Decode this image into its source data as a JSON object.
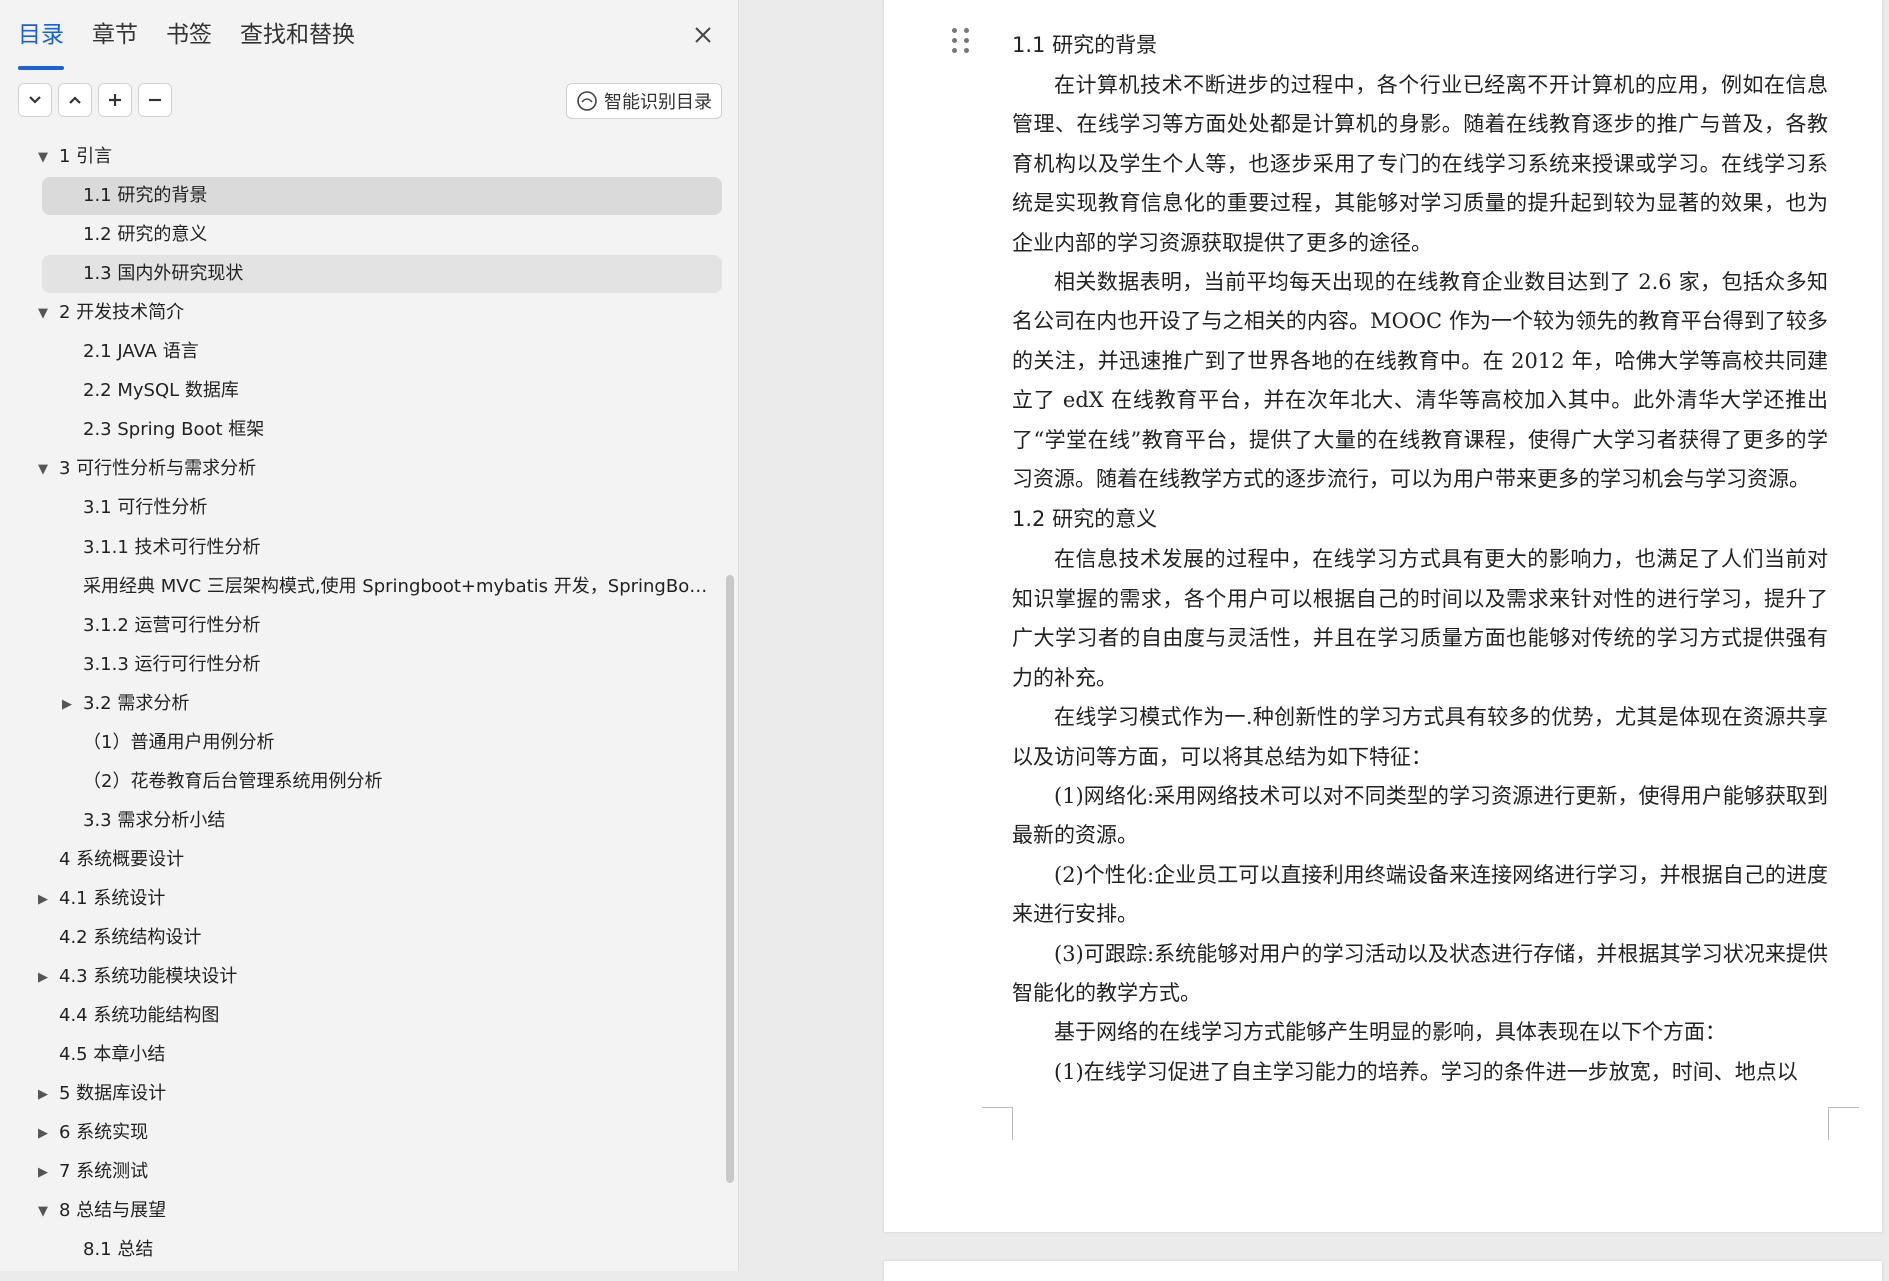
{
  "sidebar": {
    "tabs": [
      "目录",
      "章节",
      "书签",
      "查找和替换"
    ],
    "smart_label": "智能识别目录",
    "toc": [
      {
        "label": "1 引言"
      },
      {
        "label": "1.1 研究的背景"
      },
      {
        "label": "1.2 研究的意义"
      },
      {
        "label": "1.3 国内外研究现状"
      },
      {
        "label": "2 开发技术简介"
      },
      {
        "label": "2.1 JAVA 语言"
      },
      {
        "label": "2.2 MySQL 数据库"
      },
      {
        "label": "2.3 Spring Boot 框架"
      },
      {
        "label": "3 可行性分析与需求分析"
      },
      {
        "label": "3.1 可行性分析"
      },
      {
        "label": "3.1.1 技术可行性分析"
      },
      {
        "label": "采用经典 MVC 三层架构模式,使用 Springboot+mybatis 开发，SpringBoot ..."
      },
      {
        "label": "3.1.2 运营可行性分析"
      },
      {
        "label": "3.1.3 运行可行性分析"
      },
      {
        "label": "3.2 需求分析"
      },
      {
        "label": "（1）普通用户用例分析"
      },
      {
        "label": "（2）花卷教育后台管理系统用例分析"
      },
      {
        "label": "3.3 需求分析小结"
      },
      {
        "label": "4 系统概要设计"
      },
      {
        "label": "4.1 系统设计"
      },
      {
        "label": "4.2 系统结构设计"
      },
      {
        "label": "4.3 系统功能模块设计"
      },
      {
        "label": "4.4 系统功能结构图"
      },
      {
        "label": "4.5 本章小结"
      },
      {
        "label": "5 数据库设计"
      },
      {
        "label": "6 系统实现"
      },
      {
        "label": "7 系统测试"
      },
      {
        "label": "8 总结与展望"
      },
      {
        "label": "8.1 总结"
      }
    ]
  },
  "document": {
    "h1": "1.1 研究的背景",
    "p1": "在计算机技术不断进步的过程中，各个行业已经离不开计算机的应用，例如在信息管理、在线学习等方面处处都是计算机的身影。随着在线教育逐步的推广与普及，各教育机构以及学生个人等，也逐步采用了专门的在线学习系统来授课或学习。在线学习系统是实现教育信息化的重要过程，其能够对学习质量的提升起到较为显著的效果，也为企业内部的学习资源获取提供了更多的途径。",
    "p2": "相关数据表明，当前平均每天出现的在线教育企业数目达到了 2.6 家，包括众多知名公司在内也开设了与之相关的内容。MOOC 作为一个较为领先的教育平台得到了较多的关注，并迅速推广到了世界各地的在线教育中。在 2012 年，哈佛大学等高校共同建立了 edX 在线教育平台，并在次年北大、清华等高校加入其中。此外清华大学还推出了“学堂在线”教育平台，提供了大量的在线教育课程，使得广大学习者获得了更多的学习资源。随着在线教学方式的逐步流行，可以为用户带来更多的学习机会与学习资源。",
    "h2": "1.2 研究的意义",
    "p3": "在信息技术发展的过程中，在线学习方式具有更大的影响力，也满足了人们当前对知识掌握的需求，各个用户可以根据自己的时间以及需求来针对性的进行学习，提升了广大学习者的自由度与灵活性，并且在学习质量方面也能够对传统的学习方式提供强有力的补充。",
    "p4": "在线学习模式作为一.种创新性的学习方式具有较多的优势，尤其是体现在资源共享以及访问等方面，可以将其总结为如下特征：",
    "p5": "(1)网络化:采用网络技术可以对不同类型的学习资源进行更新，使得用户能够获取到最新的资源。",
    "p6": "(2)个性化:企业员工可以直接利用终端设备来连接网络进行学习，并根据自己的进度来进行安排。",
    "p7": "(3)可跟踪:系统能够对用户的学习活动以及状态进行存储，并根据其学习状况来提供智能化的教学方式。",
    "p8": "基于网络的在线学习方式能够产生明显的影响，具体表现在以下个方面：",
    "p9": "(1)在线学习促进了自主学习能力的培养。学习的条件进一步放宽，时间、地点以"
  }
}
